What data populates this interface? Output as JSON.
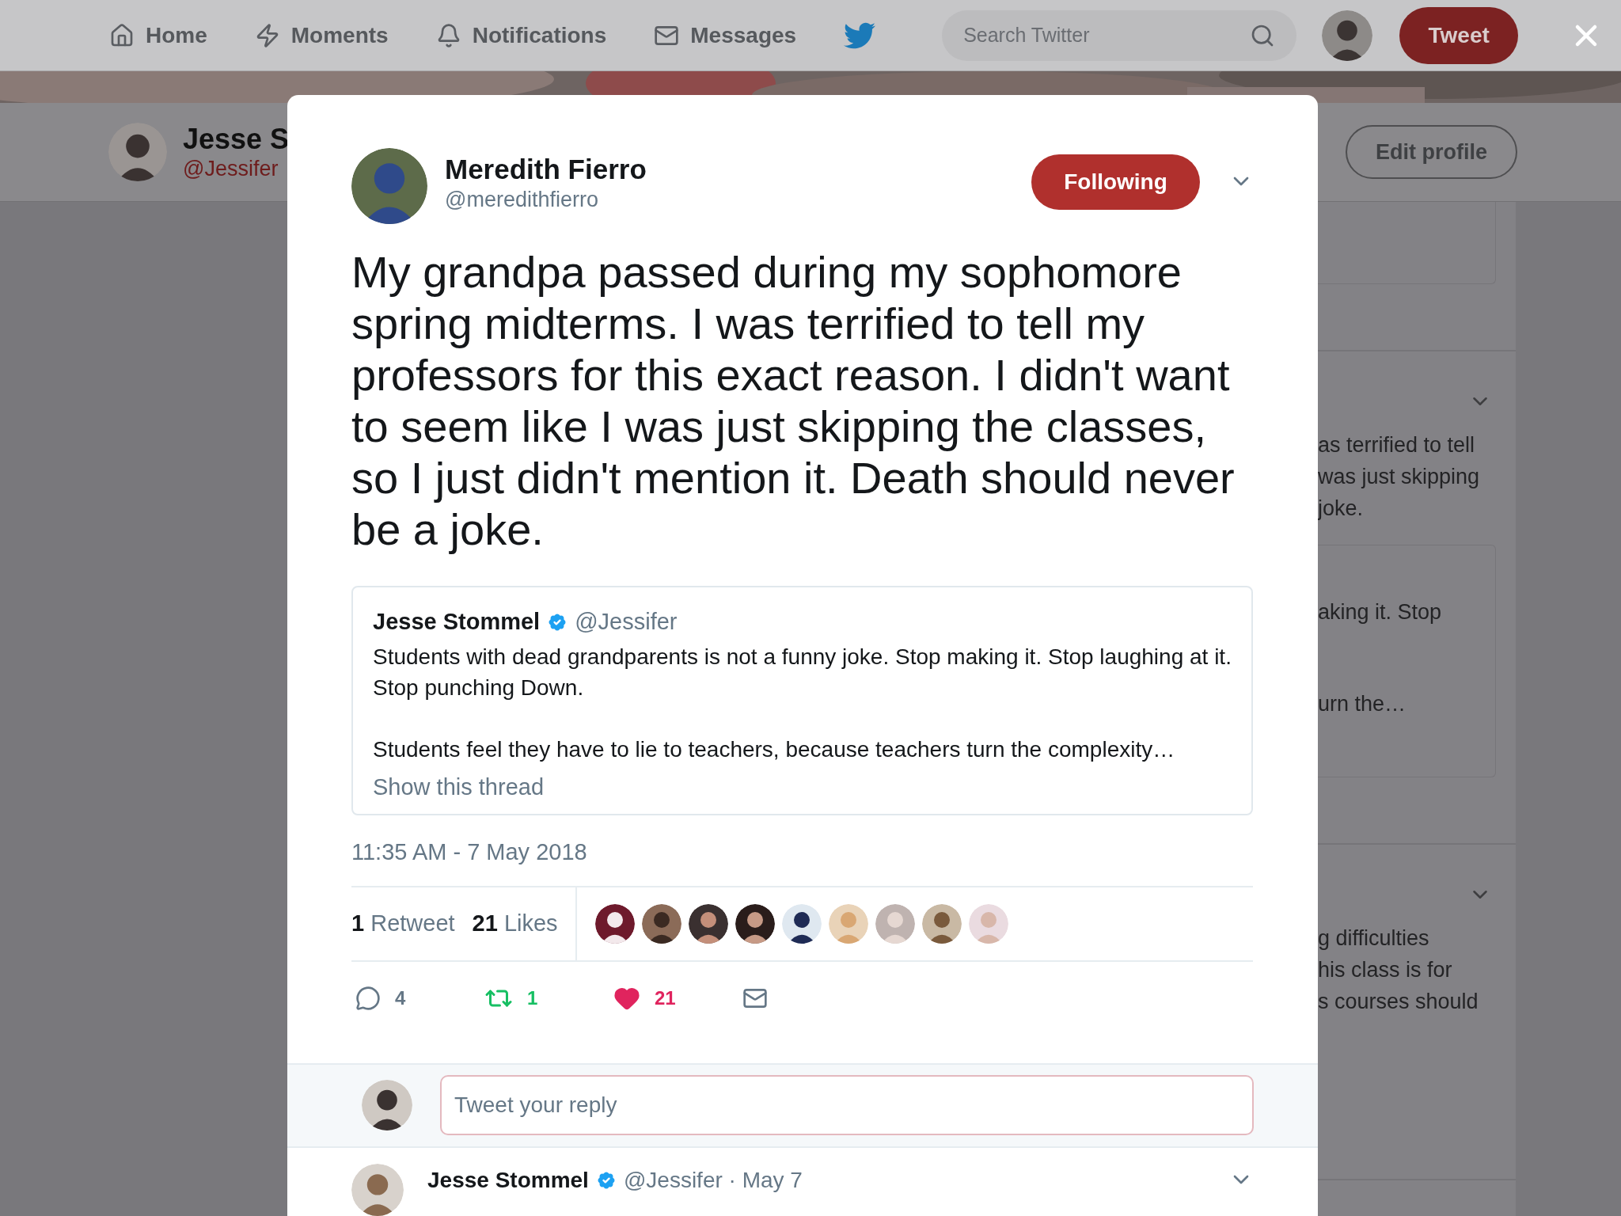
{
  "nav": {
    "items": [
      {
        "kind": "home",
        "label": "Home"
      },
      {
        "kind": "moments",
        "label": "Moments"
      },
      {
        "kind": "notifications",
        "label": "Notifications"
      },
      {
        "kind": "messages",
        "label": "Messages"
      }
    ],
    "search": {
      "placeholder": "Search Twitter"
    },
    "tweet_button": "Tweet"
  },
  "profile_bar": {
    "name": "Jesse S",
    "handle": "@Jessifer",
    "edit_button": "Edit profile"
  },
  "background_timeline": [
    {
      "lines": [
        "as terrified to tell",
        "was just skipping",
        "joke."
      ],
      "quote_lines": [
        "aking it. Stop",
        "urn the…"
      ]
    },
    {
      "lines": [
        "g difficulties",
        "his class is for",
        "s courses should"
      ]
    }
  ],
  "modal": {
    "author": {
      "name": "Meredith Fierro",
      "handle": "@meredithfierro"
    },
    "follow_button": {
      "label": "Following",
      "selected": true
    },
    "text": "My grandpa passed during my sophomore spring midterms. I was terrified to tell my professors for this exact reason. I didn't want to seem like I was just skipping the classes, so I just didn't mention it. Death should never be a joke.",
    "quote": {
      "name": "Jesse Stommel",
      "verified": true,
      "handle": "@Jessifer",
      "paragraphs": [
        "Students with dead grandparents is not a funny joke. Stop making it. Stop laughing at it. Stop punching Down.",
        "Students feel they have to lie to teachers, because teachers turn the complexity…"
      ],
      "link": "Show this thread"
    },
    "timestamp": "11:35 AM - 7 May 2018",
    "stats": [
      {
        "count": "1",
        "label": "Retweet"
      },
      {
        "count": "21",
        "label": "Likes"
      }
    ],
    "actions": [
      {
        "kind": "reply",
        "count": "4",
        "on": false
      },
      {
        "kind": "retweet",
        "count": "1",
        "on": true
      },
      {
        "kind": "like",
        "count": "21",
        "on": true
      },
      {
        "kind": "message"
      }
    ],
    "reply": {
      "placeholder": "Tweet your reply"
    },
    "next_tweet": {
      "name": "Jesse Stommel",
      "verified": true,
      "meta": "@Jessifer · May 7"
    }
  }
}
